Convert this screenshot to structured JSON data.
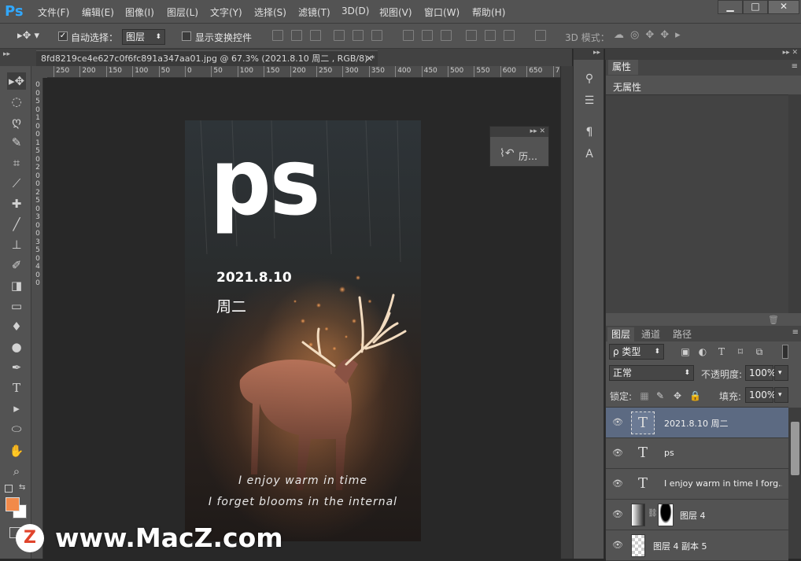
{
  "app": {
    "logo": "Ps"
  },
  "menu": [
    "文件(F)",
    "编辑(E)",
    "图像(I)",
    "图层(L)",
    "文字(Y)",
    "选择(S)",
    "滤镜(T)",
    "3D(D)",
    "视图(V)",
    "窗口(W)",
    "帮助(H)"
  ],
  "window_buttons": {
    "minimize": "▁",
    "restore": "□",
    "close": "✕"
  },
  "options": {
    "auto_select_label": "自动选择：",
    "auto_select_checked": true,
    "target_value": "图层",
    "show_transform_label": "显示变换控件",
    "mode3d_label": "3D 模式："
  },
  "document": {
    "tab_title": "8fd8219ce4e627c0f6fc891a347aa01.jpg @ 67.3% (2021.8.10 周二 , RGB/8) *",
    "close": "✕"
  },
  "ruler": {
    "h": [
      "250",
      "200",
      "150",
      "100",
      "50",
      "0",
      "50",
      "100",
      "150",
      "200",
      "250",
      "300",
      "350",
      "400",
      "450",
      "500",
      "550",
      "600",
      "650",
      "7"
    ],
    "v": [
      "0",
      "0",
      "5",
      "0",
      "1",
      "0",
      "0",
      "1",
      "5",
      "0",
      "2",
      "0",
      "0",
      "2",
      "5",
      "0",
      "3",
      "0",
      "0",
      "3",
      "5",
      "0",
      "4",
      "0",
      "0"
    ]
  },
  "artwork": {
    "title": "ps",
    "date": "2021.8.10",
    "weekday": "周二",
    "line1": "I enjoy warm in time",
    "line2": "I forget blooms in the internal"
  },
  "float_panel": {
    "label": "历…",
    "header": "▸▸ ✕"
  },
  "properties": {
    "tab": "属性",
    "content": "无属性"
  },
  "layers": {
    "tabs": [
      "图层",
      "通道",
      "路径"
    ],
    "filter_label": "ρ 类型",
    "blend_mode": "正常",
    "opacity_label": "不透明度:",
    "opacity_value": "100%",
    "lock_label": "锁定:",
    "fill_label": "填充:",
    "fill_value": "100%",
    "items": [
      {
        "name": "2021.8.10 周二",
        "thumb": "T",
        "selected": true
      },
      {
        "name": "ps",
        "thumb": "T",
        "selected": false
      },
      {
        "name": "I enjoy warm in time I forg...",
        "thumb": "T",
        "selected": false
      },
      {
        "name": "图层 4",
        "thumb": "",
        "selected": false
      },
      {
        "name": "图层 4 副本 5",
        "thumb": "",
        "selected": false
      }
    ]
  },
  "colors": {
    "foreground": "#f28a4a",
    "background": "#ffffff",
    "selected_layer": "#5c6a82"
  },
  "watermark": {
    "logo": "Z",
    "text": "www.MacZ.com"
  }
}
